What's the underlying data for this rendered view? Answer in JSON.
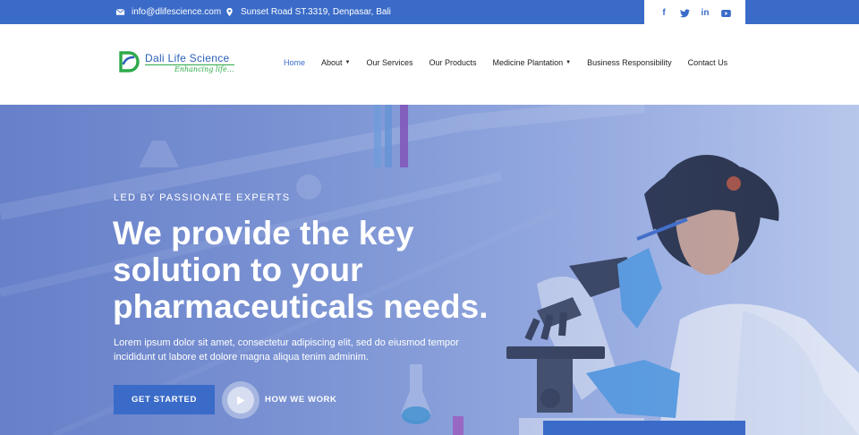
{
  "topbar": {
    "email": "info@dlifescience.com",
    "address": "Sunset Road ST.3319, Denpasar, Bali",
    "social": [
      {
        "icon": "facebook-icon",
        "glyph": "f"
      },
      {
        "icon": "twitter-icon",
        "glyph": "t"
      },
      {
        "icon": "linkedin-icon",
        "glyph": "in"
      },
      {
        "icon": "youtube-icon",
        "glyph": "▶"
      }
    ]
  },
  "logo": {
    "name": "Dali Life Science",
    "tagline": "Enhancing life..."
  },
  "nav": {
    "items": [
      {
        "label": "Home",
        "active": true,
        "dropdown": false
      },
      {
        "label": "About",
        "active": false,
        "dropdown": true
      },
      {
        "label": "Our Services",
        "active": false,
        "dropdown": false
      },
      {
        "label": "Our Products",
        "active": false,
        "dropdown": false
      },
      {
        "label": "Medicine Plantation",
        "active": false,
        "dropdown": true
      },
      {
        "label": "Business Responsibility",
        "active": false,
        "dropdown": false
      },
      {
        "label": "Contact Us",
        "active": false,
        "dropdown": false
      }
    ]
  },
  "hero": {
    "eyebrow": "LED BY PASSIONATE EXPERTS",
    "headline_1": "We provide the key",
    "headline_2": "solution to your",
    "headline_3": "pharmaceuticals needs.",
    "lead": "Lorem ipsum dolor sit amet, consectetur adipiscing elit, sed do eiusmod tempor incididunt ut labore et dolore magna aliqua tenim adminim.",
    "cta": "GET STARTED",
    "video_label": "HOW WE WORK"
  },
  "colors": {
    "brand": "#3a6bc8",
    "logo_green": "#2eaa4a"
  }
}
